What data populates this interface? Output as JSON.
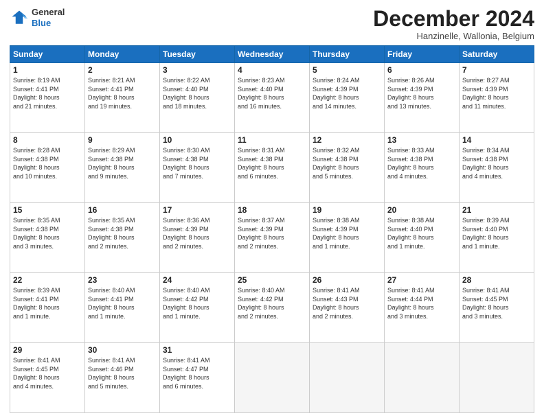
{
  "logo": {
    "general": "General",
    "blue": "Blue"
  },
  "header": {
    "month": "December 2024",
    "location": "Hanzinelle, Wallonia, Belgium"
  },
  "weekdays": [
    "Sunday",
    "Monday",
    "Tuesday",
    "Wednesday",
    "Thursday",
    "Friday",
    "Saturday"
  ],
  "weeks": [
    [
      {
        "day": "1",
        "info": "Sunrise: 8:19 AM\nSunset: 4:41 PM\nDaylight: 8 hours\nand 21 minutes."
      },
      {
        "day": "2",
        "info": "Sunrise: 8:21 AM\nSunset: 4:41 PM\nDaylight: 8 hours\nand 19 minutes."
      },
      {
        "day": "3",
        "info": "Sunrise: 8:22 AM\nSunset: 4:40 PM\nDaylight: 8 hours\nand 18 minutes."
      },
      {
        "day": "4",
        "info": "Sunrise: 8:23 AM\nSunset: 4:40 PM\nDaylight: 8 hours\nand 16 minutes."
      },
      {
        "day": "5",
        "info": "Sunrise: 8:24 AM\nSunset: 4:39 PM\nDaylight: 8 hours\nand 14 minutes."
      },
      {
        "day": "6",
        "info": "Sunrise: 8:26 AM\nSunset: 4:39 PM\nDaylight: 8 hours\nand 13 minutes."
      },
      {
        "day": "7",
        "info": "Sunrise: 8:27 AM\nSunset: 4:39 PM\nDaylight: 8 hours\nand 11 minutes."
      }
    ],
    [
      {
        "day": "8",
        "info": "Sunrise: 8:28 AM\nSunset: 4:38 PM\nDaylight: 8 hours\nand 10 minutes."
      },
      {
        "day": "9",
        "info": "Sunrise: 8:29 AM\nSunset: 4:38 PM\nDaylight: 8 hours\nand 9 minutes."
      },
      {
        "day": "10",
        "info": "Sunrise: 8:30 AM\nSunset: 4:38 PM\nDaylight: 8 hours\nand 7 minutes."
      },
      {
        "day": "11",
        "info": "Sunrise: 8:31 AM\nSunset: 4:38 PM\nDaylight: 8 hours\nand 6 minutes."
      },
      {
        "day": "12",
        "info": "Sunrise: 8:32 AM\nSunset: 4:38 PM\nDaylight: 8 hours\nand 5 minutes."
      },
      {
        "day": "13",
        "info": "Sunrise: 8:33 AM\nSunset: 4:38 PM\nDaylight: 8 hours\nand 4 minutes."
      },
      {
        "day": "14",
        "info": "Sunrise: 8:34 AM\nSunset: 4:38 PM\nDaylight: 8 hours\nand 4 minutes."
      }
    ],
    [
      {
        "day": "15",
        "info": "Sunrise: 8:35 AM\nSunset: 4:38 PM\nDaylight: 8 hours\nand 3 minutes."
      },
      {
        "day": "16",
        "info": "Sunrise: 8:35 AM\nSunset: 4:38 PM\nDaylight: 8 hours\nand 2 minutes."
      },
      {
        "day": "17",
        "info": "Sunrise: 8:36 AM\nSunset: 4:39 PM\nDaylight: 8 hours\nand 2 minutes."
      },
      {
        "day": "18",
        "info": "Sunrise: 8:37 AM\nSunset: 4:39 PM\nDaylight: 8 hours\nand 2 minutes."
      },
      {
        "day": "19",
        "info": "Sunrise: 8:38 AM\nSunset: 4:39 PM\nDaylight: 8 hours\nand 1 minute."
      },
      {
        "day": "20",
        "info": "Sunrise: 8:38 AM\nSunset: 4:40 PM\nDaylight: 8 hours\nand 1 minute."
      },
      {
        "day": "21",
        "info": "Sunrise: 8:39 AM\nSunset: 4:40 PM\nDaylight: 8 hours\nand 1 minute."
      }
    ],
    [
      {
        "day": "22",
        "info": "Sunrise: 8:39 AM\nSunset: 4:41 PM\nDaylight: 8 hours\nand 1 minute."
      },
      {
        "day": "23",
        "info": "Sunrise: 8:40 AM\nSunset: 4:41 PM\nDaylight: 8 hours\nand 1 minute."
      },
      {
        "day": "24",
        "info": "Sunrise: 8:40 AM\nSunset: 4:42 PM\nDaylight: 8 hours\nand 1 minute."
      },
      {
        "day": "25",
        "info": "Sunrise: 8:40 AM\nSunset: 4:42 PM\nDaylight: 8 hours\nand 2 minutes."
      },
      {
        "day": "26",
        "info": "Sunrise: 8:41 AM\nSunset: 4:43 PM\nDaylight: 8 hours\nand 2 minutes."
      },
      {
        "day": "27",
        "info": "Sunrise: 8:41 AM\nSunset: 4:44 PM\nDaylight: 8 hours\nand 3 minutes."
      },
      {
        "day": "28",
        "info": "Sunrise: 8:41 AM\nSunset: 4:45 PM\nDaylight: 8 hours\nand 3 minutes."
      }
    ],
    [
      {
        "day": "29",
        "info": "Sunrise: 8:41 AM\nSunset: 4:45 PM\nDaylight: 8 hours\nand 4 minutes."
      },
      {
        "day": "30",
        "info": "Sunrise: 8:41 AM\nSunset: 4:46 PM\nDaylight: 8 hours\nand 5 minutes."
      },
      {
        "day": "31",
        "info": "Sunrise: 8:41 AM\nSunset: 4:47 PM\nDaylight: 8 hours\nand 6 minutes."
      },
      null,
      null,
      null,
      null
    ]
  ]
}
